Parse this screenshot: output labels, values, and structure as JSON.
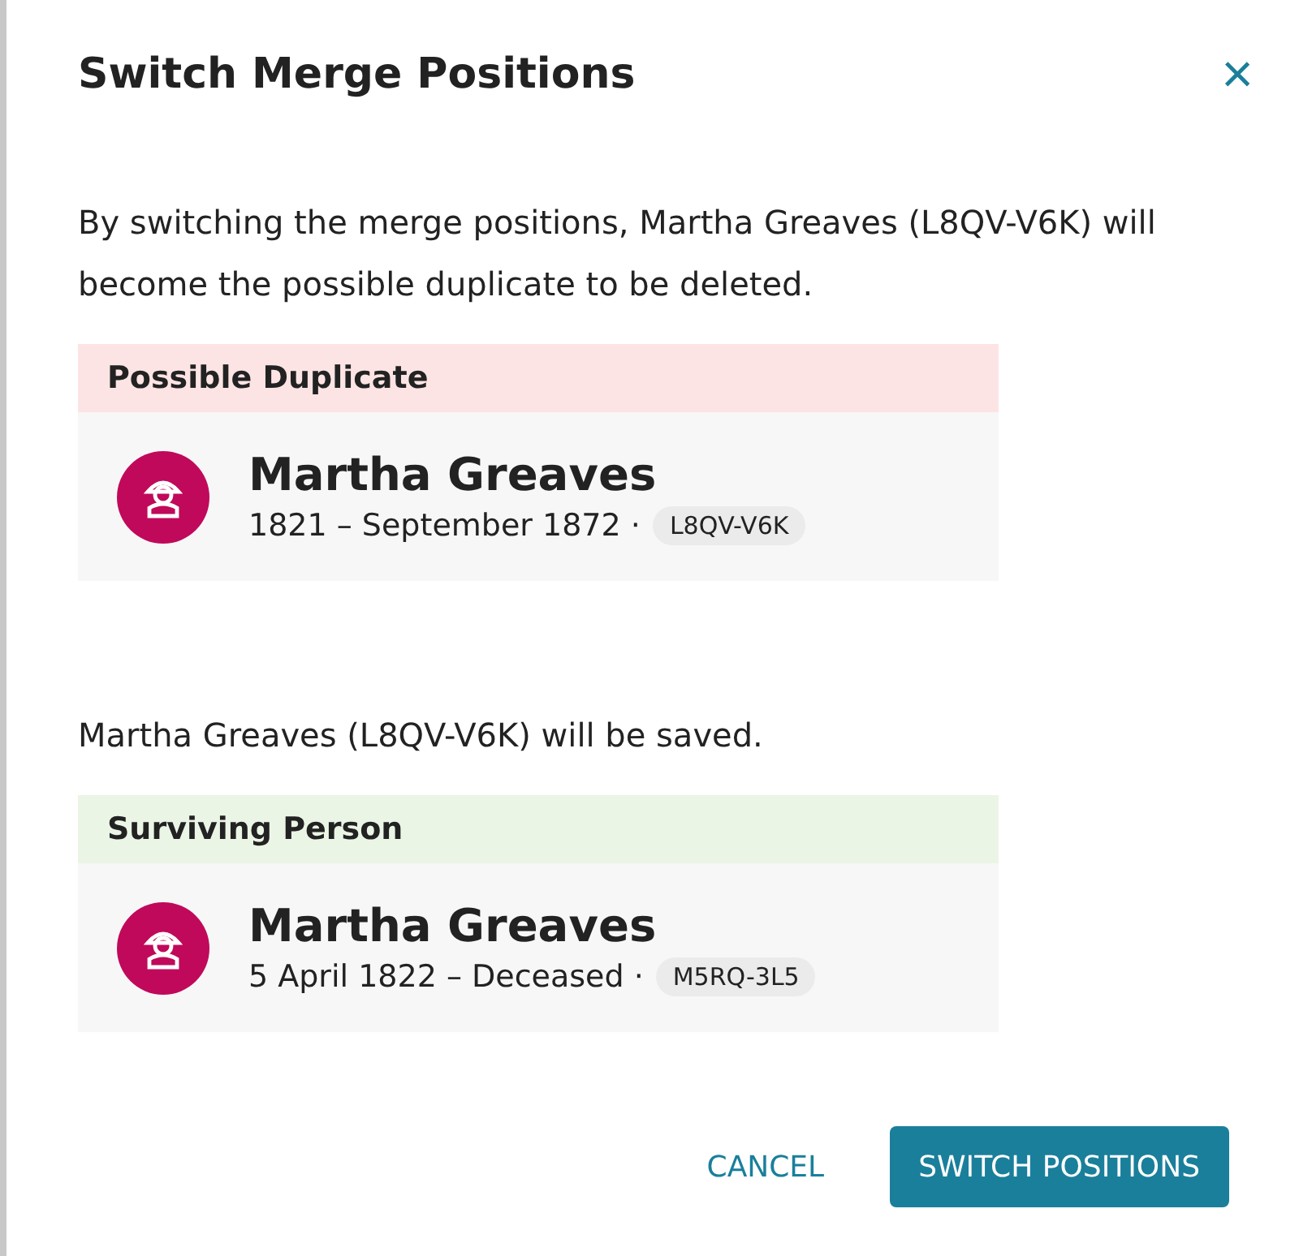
{
  "dialog": {
    "title": "Switch Merge Positions",
    "close": "×"
  },
  "sections": [
    {
      "message": "By switching the merge positions, Martha Greaves (L8QV-V6K) will become the possible duplicate to be deleted.",
      "card": {
        "kind": "duplicate",
        "heading": "Possible Duplicate",
        "name": "Martha Greaves",
        "dates": "1821 – September 1872 ·",
        "id": "L8QV-V6K"
      }
    },
    {
      "message": "Martha Greaves (L8QV-V6K) will be saved.",
      "card": {
        "kind": "surviving",
        "heading": "Surviving Person",
        "name": "Martha Greaves",
        "dates": "5 April 1822 – Deceased ·",
        "id": "M5RQ-3L5"
      }
    }
  ],
  "buttons": [
    {
      "label": "CANCEL",
      "kind": "text"
    },
    {
      "label": "SWITCH POSITIONS",
      "kind": "primary"
    }
  ]
}
